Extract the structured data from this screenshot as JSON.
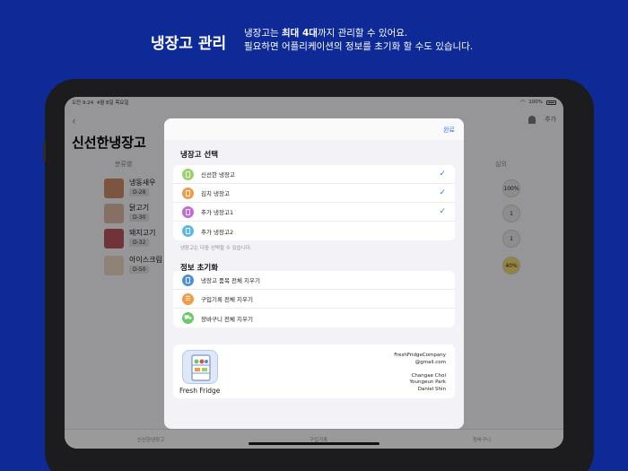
{
  "promo": {
    "title": "냉장고 관리",
    "line1_pre": "냉장고는 ",
    "line1_bold": "최대 4대",
    "line1_post": "까지 관리할 수 있어요.",
    "line2": "필요하면 어플리케이션의 정보를 초기화 할 수도 있습니다."
  },
  "status": {
    "time": "오전 9:24",
    "date": "4월 8일 목요일",
    "battery": "100%"
  },
  "app": {
    "add_label": "추가",
    "title": "신선한냉장고",
    "col_category": "분류별",
    "col_actual": "실외",
    "rows": [
      {
        "name": "냉동새우",
        "dday": "D-28",
        "pct": "100%"
      },
      {
        "name": "닭고기",
        "dday": "D-30",
        "pct": "1"
      },
      {
        "name": "돼지고기",
        "dday": "D-32",
        "pct": "1"
      },
      {
        "name": "아이스크림",
        "dday": "D-50",
        "pct": "40%"
      }
    ],
    "tabs": [
      "신선한냉장고",
      "구입기록",
      "장바구니"
    ]
  },
  "modal": {
    "done": "완료",
    "fridge_section": "냉장고 선택",
    "fridges": [
      {
        "label": "신선한 냉장고",
        "checked": true,
        "color": "#9bd36b"
      },
      {
        "label": "김치 냉장고",
        "checked": true,
        "color": "#f29a46"
      },
      {
        "label": "추가 냉장고1",
        "checked": true,
        "color": "#c46ad8"
      },
      {
        "label": "추가 냉장고2",
        "checked": false,
        "color": "#5cb8ec"
      }
    ],
    "fridge_hint": "냉장고는 다중 선택할 수 있습니다.",
    "reset_section": "정보 초기화",
    "resets": [
      {
        "label": "냉장고 품목 전체 지우기",
        "color": "#4a8fe0"
      },
      {
        "label": "구입기록 전체 지우기",
        "color": "#f29a46"
      },
      {
        "label": "장바구니 전체 지우기",
        "color": "#6cc96a"
      }
    ],
    "app_name": "Fresh Fridge",
    "credits": [
      "FreshFridgeCompany",
      "@gmail.com",
      "",
      "Changae Choi",
      "Youngeun Park",
      "Daniel Shin"
    ]
  }
}
